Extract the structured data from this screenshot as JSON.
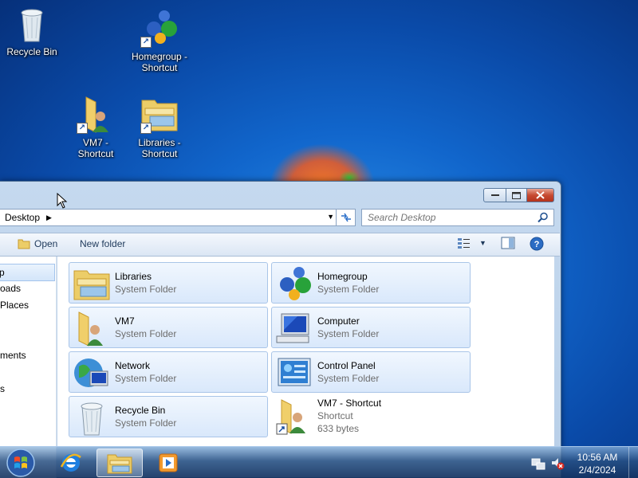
{
  "desktop": {
    "icons": [
      {
        "label": "Recycle Bin",
        "icon": "recycle-bin-icon"
      },
      {
        "label": "Homegroup -\nShortcut",
        "icon": "homegroup-icon"
      },
      {
        "label": "VM7 -\nShortcut",
        "icon": "user-folder-icon"
      },
      {
        "label": "Libraries -\nShortcut",
        "icon": "libraries-icon"
      }
    ]
  },
  "window": {
    "caption_buttons": {
      "minimize": "minimize",
      "maximize": "maximize",
      "close": "close"
    },
    "address": {
      "crumb": "Desktop"
    },
    "search": {
      "placeholder": "Search Desktop"
    },
    "toolbar": {
      "open_label": "Open",
      "new_folder_label": "New folder"
    },
    "nav_pane": [
      {
        "label": "p",
        "selected": true
      },
      {
        "label": "oads"
      },
      {
        "label": " Places"
      },
      {
        "label": "ments"
      },
      {
        "label": "s"
      }
    ],
    "items": [
      {
        "name": "Libraries",
        "type": "System Folder",
        "icon": "libraries-icon"
      },
      {
        "name": "Homegroup",
        "type": "System Folder",
        "icon": "homegroup-icon"
      },
      {
        "name": "VM7",
        "type": "System Folder",
        "icon": "user-folder-icon"
      },
      {
        "name": "Computer",
        "type": "System Folder",
        "icon": "computer-icon"
      },
      {
        "name": "Network",
        "type": "System Folder",
        "icon": "network-icon"
      },
      {
        "name": "Control Panel",
        "type": "System Folder",
        "icon": "control-panel-icon"
      },
      {
        "name": "Recycle Bin",
        "type": "System Folder",
        "icon": "recycle-bin-icon"
      },
      {
        "name": "VM7 - Shortcut",
        "type": "Shortcut",
        "size": "633 bytes",
        "icon": "user-folder-shortcut-icon"
      }
    ]
  },
  "taskbar": {
    "apps": [
      "internet-explorer-icon",
      "windows-explorer-icon",
      "media-player-icon"
    ],
    "clock": {
      "time": "10:56 AM",
      "date": "2/4/2024"
    }
  },
  "colors": {
    "tile_border": "#a9c5e8",
    "close_button": "#c74a32",
    "accent_blue": "#2a6fc9"
  }
}
